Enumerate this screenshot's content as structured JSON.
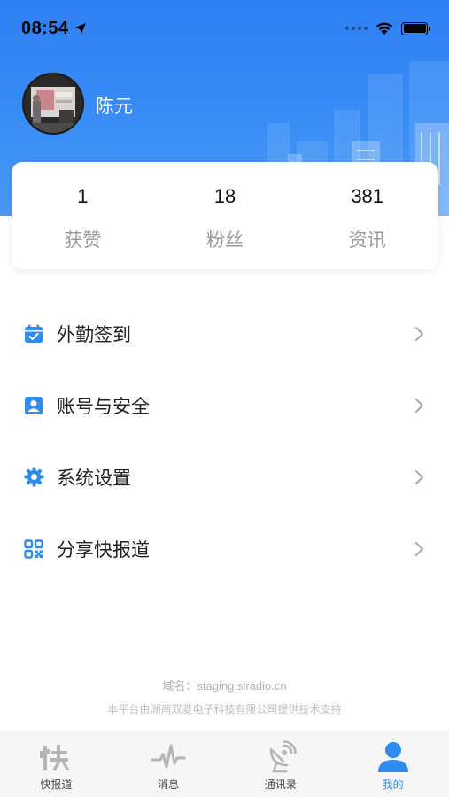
{
  "status_bar": {
    "time": "08:54"
  },
  "profile": {
    "name": "陈元"
  },
  "stats": [
    {
      "value": "1",
      "label": "获赞"
    },
    {
      "value": "18",
      "label": "粉丝"
    },
    {
      "value": "381",
      "label": "资讯"
    }
  ],
  "menu": [
    {
      "label": "外勤签到",
      "icon": "calendar-check-icon"
    },
    {
      "label": "账号与安全",
      "icon": "contact-card-icon"
    },
    {
      "label": "系统设置",
      "icon": "gear-icon"
    },
    {
      "label": "分享快报道",
      "icon": "qr-code-icon"
    }
  ],
  "footer": {
    "domain": "域名：staging.slradio.cn",
    "support": "本平台由湖南双菱电子科技有限公司提供技术支持"
  },
  "tabs": [
    {
      "label": "快报道",
      "icon": "kuai-logo-icon",
      "active": false
    },
    {
      "label": "消息",
      "icon": "pulse-icon",
      "active": false
    },
    {
      "label": "通讯录",
      "icon": "satellite-dish-icon",
      "active": false
    },
    {
      "label": "我的",
      "icon": "user-icon",
      "active": true
    }
  ],
  "colors": {
    "primary": "#2e7ff4",
    "accent_icon": "#2f8bf0",
    "active_tab": "#2f8bf0"
  }
}
